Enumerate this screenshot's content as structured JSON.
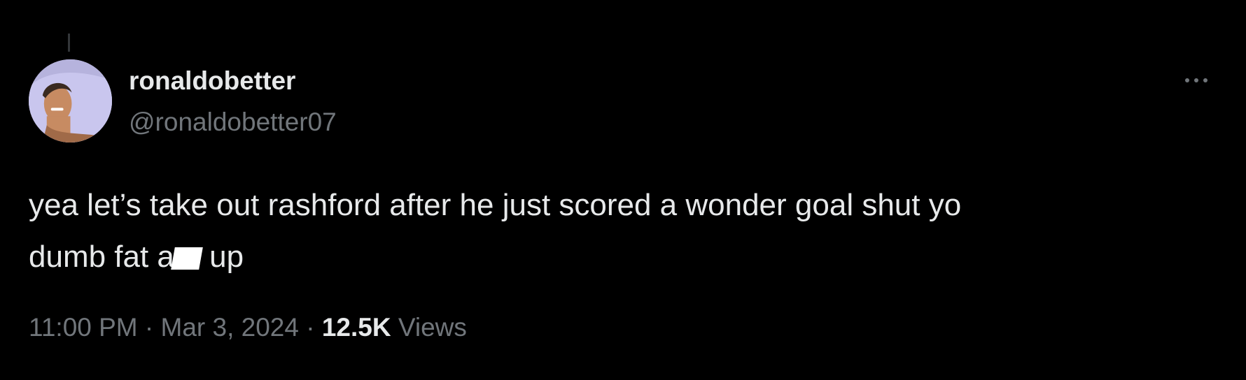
{
  "tweet": {
    "author": {
      "display_name": "ronaldobetter",
      "handle": "@ronaldobetter07"
    },
    "text_lines": [
      "yea let’s take out rashford after he just scored a wonder goal shut yo",
      "dumb fat a",
      " up"
    ],
    "meta": {
      "time": "11:00 PM",
      "separator": " · ",
      "date": "Mar 3, 2024",
      "views_count": "12.5K",
      "views_label": " Views"
    }
  },
  "icons": {
    "more": "more-horizontal-icon",
    "avatar": "user-avatar-image"
  },
  "colors": {
    "background": "#000000",
    "primary_text": "#e7e9ea",
    "secondary_text": "#71767b",
    "censor_box": "#ffffff"
  }
}
